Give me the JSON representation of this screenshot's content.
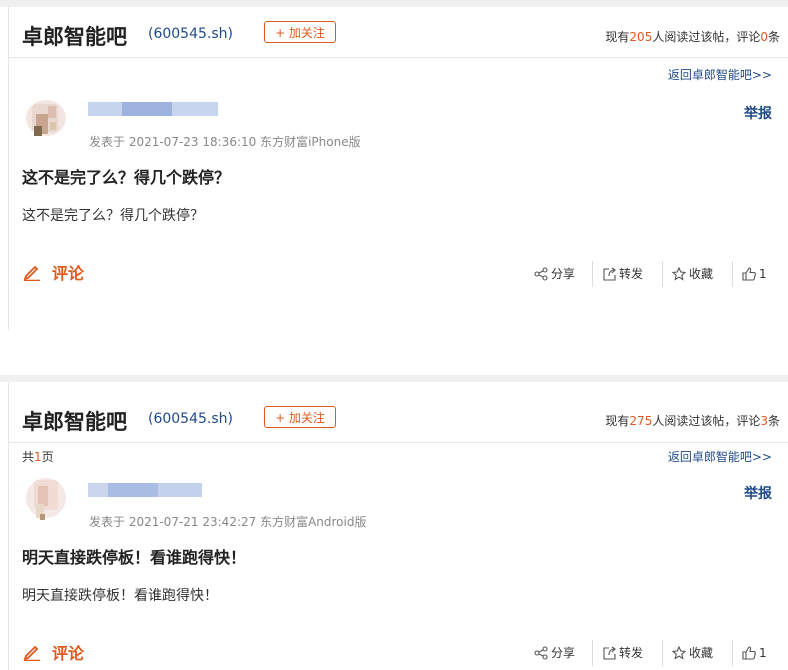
{
  "posts": [
    {
      "bar_name": "卓郎智能吧",
      "stock_code": "(600545.sh)",
      "follow_label": "+ 加关注",
      "read_prefix": "现有",
      "read_count": "205",
      "read_mid": "人阅读过该帖，评论",
      "comment_count": "0",
      "read_suffix": "条",
      "back_link": "返回卓郎智能吧>>",
      "meta": "发表于 2021-07-23 18:36:10 东方财富iPhone版",
      "report_label": "举报",
      "title": "这不是完了么？得几个跌停？",
      "content": "这不是完了么？得几个跌停？",
      "comment_label": "评论",
      "share_label": "分享",
      "forward_label": "转发",
      "favorite_label": "收藏",
      "like_count": "1"
    },
    {
      "bar_name": "卓郎智能吧",
      "stock_code": "(600545.sh)",
      "follow_label": "+ 加关注",
      "read_prefix": "现有",
      "read_count": "275",
      "read_mid": "人阅读过该帖，评论",
      "comment_count": "3",
      "read_suffix": "条",
      "page_prefix": "共",
      "page_count": "1",
      "page_suffix": "页",
      "back_link": "返回卓郎智能吧>>",
      "meta": "发表于 2021-07-21 23:42:27 东方财富Android版",
      "report_label": "举报",
      "title": "明天直接跌停板！看谁跑得快！",
      "content": "明天直接跌停板！看谁跑得快！",
      "comment_label": "评论",
      "share_label": "分享",
      "forward_label": "转发",
      "favorite_label": "收藏",
      "like_count": "1"
    }
  ],
  "colors": {
    "accent": "#e05a1f",
    "link": "#1f4a87"
  },
  "icons": [
    "pencil-icon",
    "share-icon",
    "forward-icon",
    "star-icon",
    "thumbs-up-icon"
  ]
}
